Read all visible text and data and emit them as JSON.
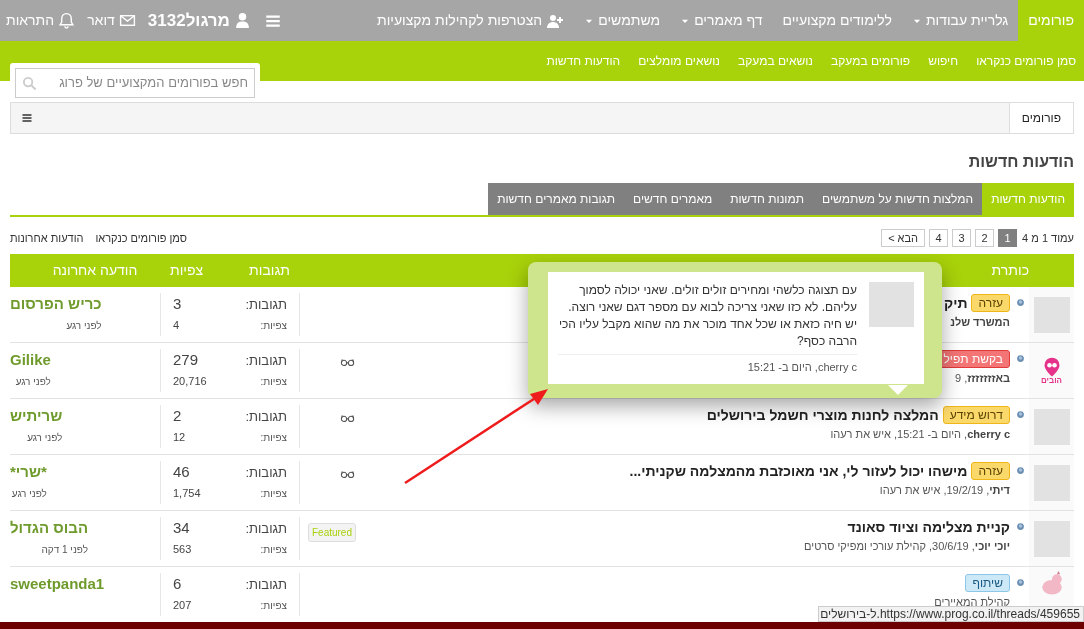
{
  "top_nav": [
    {
      "kind": "link",
      "label": "פורומים",
      "selected": true
    },
    {
      "kind": "dropdown",
      "label": "גלריית עבודות",
      "selected": false
    },
    {
      "kind": "link",
      "label": "ללימודים מקצועיים",
      "selected": false
    },
    {
      "kind": "dropdown",
      "label": "דף מאמרים",
      "selected": false
    },
    {
      "kind": "dropdown",
      "label": "משתמשים",
      "selected": false
    },
    {
      "kind": "join",
      "label": "הצטרפות לקהילות מקצועיות",
      "selected": false
    }
  ],
  "user_nav": [
    {
      "kind": "menu"
    },
    {
      "kind": "user",
      "label": "מרגול3132"
    },
    {
      "kind": "mail",
      "label": "דואר"
    },
    {
      "kind": "bell",
      "label": "התראות"
    }
  ],
  "sub_nav": [
    "סמן פורומים כנקראו",
    "חיפוש",
    "פורומים במעקב",
    "נושאים במעקב",
    "נושאים מומלצים",
    "הודעות חדשות"
  ],
  "search": {
    "placeholder": "חפש בפורומים המקצועיים של פרוג"
  },
  "breadcrumb": [
    "פורומים"
  ],
  "heading": "הודעות חדשות",
  "tabs": [
    {
      "label": "הודעות חדשות",
      "selected": true
    },
    {
      "label": "המלצות חדשות על משתמשים",
      "selected": false
    },
    {
      "label": "תמונות חדשות",
      "selected": false
    },
    {
      "label": "מאמרים חדשים",
      "selected": false
    },
    {
      "label": "תגובות מאמרים חדשות",
      "selected": false
    }
  ],
  "pagination": {
    "label": "עמוד 1 מ 4",
    "pages": [
      {
        "label": "1",
        "selected": true
      },
      {
        "label": "2",
        "selected": false
      },
      {
        "label": "3",
        "selected": false
      },
      {
        "label": "4",
        "selected": false
      }
    ],
    "next": "הבא >"
  },
  "links": [
    "סמן פורומים כנקראו",
    "הודעות אחרונות"
  ],
  "table": {
    "columns": [
      "כותרת",
      "תגובות",
      "צפיות",
      "הודעה אחרונה"
    ],
    "rows": [
      {
        "avatar": {
          "kind": "logo"
        },
        "prefix": {
          "kind": "warning",
          "label": "עזרה"
        },
        "title": "תיק",
        "author": "המשרד שלנ",
        "replies_label": "תגובות:",
        "replies": "3",
        "views_label": "צפיות:",
        "views": "4",
        "last_user": "כריש הפרסום",
        "last_time": "לפני רגע"
      },
      {
        "avatar": {
          "kind": "pin",
          "text": "הובים"
        },
        "prefix": {
          "kind": "danger",
          "label": "בקשת תפיל"
        },
        "author": "באזזזזזזז",
        "meta": ", 9",
        "flag": {
          "kind": "watched"
        },
        "replies_label": "תגובות:",
        "replies": "279",
        "views_label": "צפיות:",
        "views": "20,716",
        "last_user": "Gilike",
        "last_time": "לפני רגע"
      },
      {
        "avatar": {
          "kind": "logo"
        },
        "prefix": {
          "kind": "warning",
          "label": "דרוש מידע"
        },
        "title": "המלצה לחנות מוצרי חשמל בירושלים",
        "author": "cherry c",
        "meta": ", היום ב- 15:21, איש את רעהו",
        "flag": {
          "kind": "watched"
        },
        "replies_label": "תגובות:",
        "replies": "2",
        "views_label": "צפיות:",
        "views": "12",
        "last_user": "שריתיש",
        "last_time": "לפני רגע"
      },
      {
        "avatar": {
          "kind": "logo"
        },
        "prefix": {
          "kind": "warning",
          "label": "עזרה"
        },
        "title": "מישהו יכול לעזור לי, אני מאוכזבת מהמצלמה שקניתי...",
        "author": "דיתי",
        "meta": ", 19/2/19, איש את רעהו",
        "flag": {
          "kind": "watched"
        },
        "replies_label": "תגובות:",
        "replies": "46",
        "views_label": "צפיות:",
        "views": "1,754",
        "last_user": "*שרי*",
        "last_time": "לפני רגע"
      },
      {
        "avatar": {
          "kind": "logo"
        },
        "title": "קניית מצלימה וציוד סאונד",
        "author": "יוכי יוכי",
        "meta": ", 30/6/19, קהילת עורכי ומפיקי סרטים",
        "flag": {
          "kind": "featured",
          "label": "Featured"
        },
        "replies_label": "תגובות:",
        "replies": "34",
        "views_label": "צפיות:",
        "views": "563",
        "last_user": "הבוס הגדול",
        "last_time": "לפני 1 דקה"
      },
      {
        "avatar": {
          "kind": "animal"
        },
        "prefix": {
          "kind": "info",
          "label": "שיתוף"
        },
        "meta": "קהילת המאיירים",
        "replies_label": "תגובות:",
        "replies": "6",
        "views_label": "צפיות:",
        "views": "207",
        "last_user": "sweetpanda1"
      }
    ]
  },
  "popup": {
    "text": "עם תצוגה כלשהי ומחירים זולים זולים. שאני יכולה לסמוך עליהם. לא כזו שאני צריכה לבוא עם מספר דגם שאני רוצה. יש חיה כזאת או שכל אחד מוכר את מה שהוא מקבל עליו הכי הרבה כסף?",
    "footer": "cherry c, היום ב- 15:21"
  },
  "status_bar": {
    "url": "https://www.prog.co.il/threads/459655.ל-בירושלים"
  }
}
